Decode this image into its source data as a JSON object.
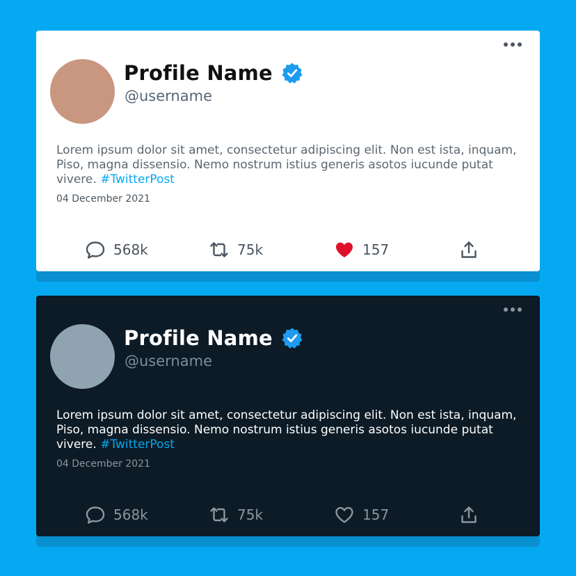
{
  "colors": {
    "background": "#04a9f1",
    "accent": "#04a9f1",
    "light_card": "#ffffff",
    "dark_card": "#0d1b26",
    "liked_heart": "#e0102b",
    "light_avatar": "#c99680",
    "dark_avatar": "#8fa4b0"
  },
  "light_post": {
    "profile_name": "Profile Name",
    "username": "@username",
    "body": "Lorem ipsum dolor sit amet, consectetur adipiscing elit. Non est ista, inquam, Piso, magna dissensio. Nemo nostrum istius generis asotos iucunde putat vivere. ",
    "hashtag": "#TwitterPost",
    "date": "04 December 2021",
    "replies": "568k",
    "retweets": "75k",
    "likes": "157",
    "liked": true,
    "icons": [
      "more-dots-icon",
      "verified-badge-icon",
      "comment-icon",
      "retweet-icon",
      "heart-filled-icon",
      "share-icon"
    ]
  },
  "dark_post": {
    "profile_name": "Profile Name",
    "username": "@username",
    "body": "Lorem ipsum dolor sit amet, consectetur adipiscing elit. Non est ista, inquam, Piso, magna dissensio. Nemo nostrum istius generis asotos iucunde putat vivere. ",
    "hashtag": "#TwitterPost",
    "date": "04 December 2021",
    "replies": "568k",
    "retweets": "75k",
    "likes": "157",
    "liked": false,
    "icons": [
      "more-dots-icon",
      "verified-badge-icon",
      "comment-icon",
      "retweet-icon",
      "heart-outline-icon",
      "share-icon"
    ]
  }
}
